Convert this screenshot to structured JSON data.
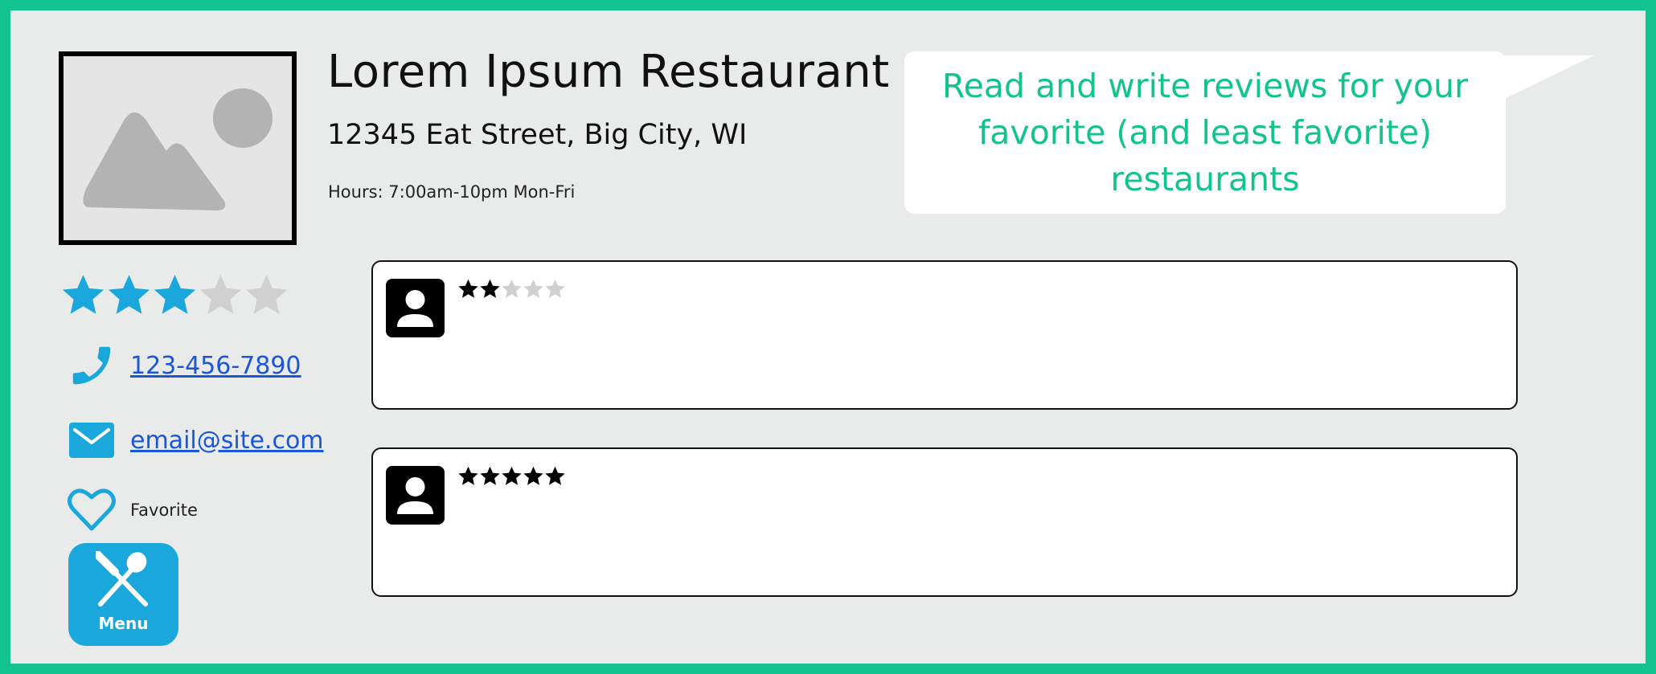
{
  "restaurant": {
    "name": "Lorem Ipsum Restaurant",
    "address": "12345 Eat Street, Big City, WI",
    "hours": "Hours: 7:00am-10pm Mon-Fri",
    "rating": 3,
    "rating_max": 5
  },
  "callout": {
    "text": "Read and write reviews for your favorite (and least favorite) restaurants"
  },
  "contact": {
    "phone": "123-456-7890",
    "email": "email@site.com",
    "favorite_label": "Favorite"
  },
  "menu_button": {
    "label": "Menu"
  },
  "reviews": [
    {
      "rating": 2,
      "rating_max": 5
    },
    {
      "rating": 5,
      "rating_max": 5
    }
  ],
  "colors": {
    "accent_green": "#12c38e",
    "accent_blue": "#1aa8dc",
    "star_empty": "#d0d0d0",
    "link": "#1a56d8"
  },
  "icons": [
    "image-placeholder-icon",
    "star-icon",
    "phone-icon",
    "mail-icon",
    "heart-icon",
    "utensils-icon",
    "user-icon"
  ]
}
